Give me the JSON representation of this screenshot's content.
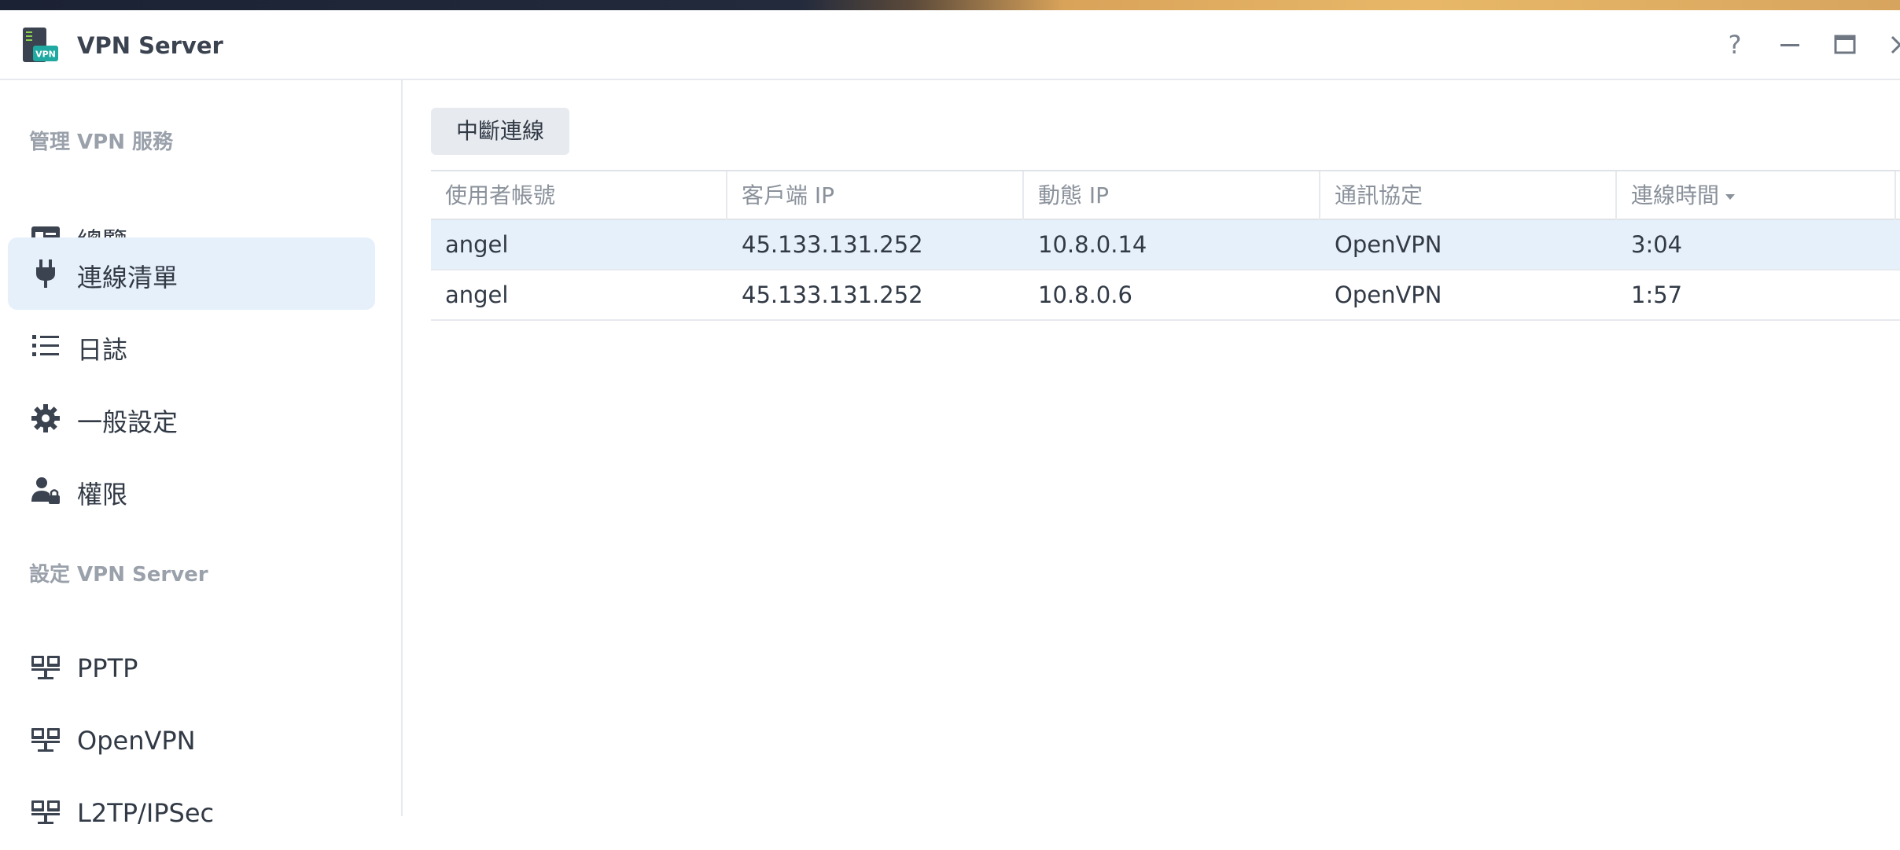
{
  "window": {
    "title": "VPN Server",
    "controls": {
      "help": "?",
      "minimize": "–",
      "maximize": "▭",
      "close": "✕"
    }
  },
  "sidebar": {
    "section1_title": "管理 VPN 服務",
    "section1_items": [
      {
        "label": "總覽",
        "icon": "overview-card-icon"
      },
      {
        "label": "連線清單",
        "icon": "plug-icon",
        "active": true
      },
      {
        "label": "日誌",
        "icon": "list-icon"
      },
      {
        "label": "一般設定",
        "icon": "gear-icon"
      },
      {
        "label": "權限",
        "icon": "user-lock-icon"
      }
    ],
    "section2_title": "設定 VPN Server",
    "section2_items": [
      {
        "label": "PPTP",
        "icon": "network-icon"
      },
      {
        "label": "OpenVPN",
        "icon": "network-icon"
      },
      {
        "label": "L2TP/IPSec",
        "icon": "network-icon"
      }
    ]
  },
  "main": {
    "toolbar": {
      "disconnect_label": "中斷連線"
    },
    "table": {
      "columns": [
        "使用者帳號",
        "客戶端 IP",
        "動態 IP",
        "通訊協定",
        "連線時間"
      ],
      "sorted_column": "連線時間",
      "rows": [
        {
          "user": "angel",
          "client_ip": "45.133.131.252",
          "dynamic_ip": "10.8.0.14",
          "protocol": "OpenVPN",
          "time": "3:04",
          "selected": true
        },
        {
          "user": "angel",
          "client_ip": "45.133.131.252",
          "dynamic_ip": "10.8.0.6",
          "protocol": "OpenVPN",
          "time": "1:57",
          "selected": false
        }
      ]
    }
  },
  "colors": {
    "accent_bg": "#e6f0fb",
    "text": "#323a46",
    "muted": "#9aa1ab",
    "vpn_badge": "#1fa9a0"
  }
}
